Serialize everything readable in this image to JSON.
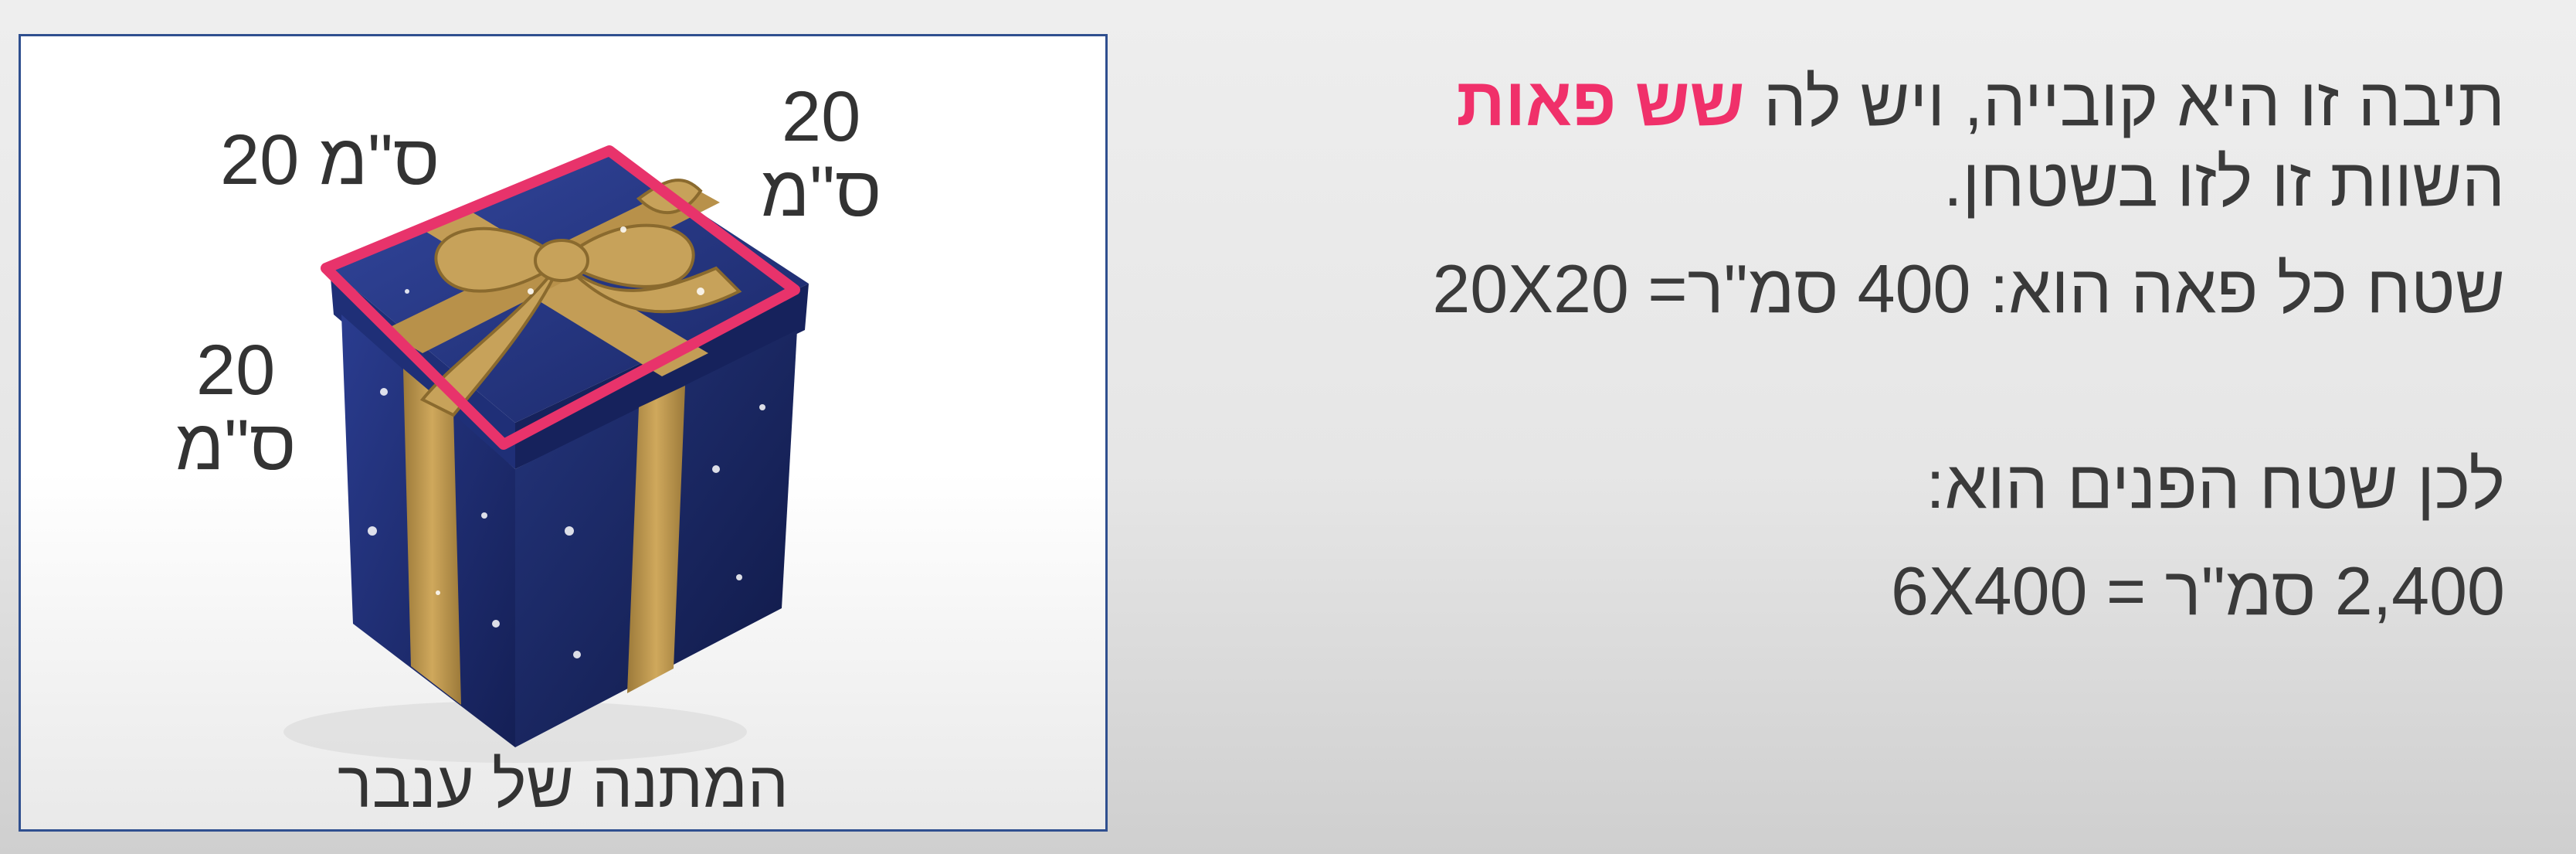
{
  "image_panel": {
    "dim_top_left": "20 ס\"מ",
    "dim_top_right_number": "20",
    "dim_top_right_unit": "ס\"מ",
    "dim_left_number": "20",
    "dim_left_unit": "ס\"מ",
    "caption": "המתנה של ענבר",
    "colors": {
      "frame_border": "#2f4f8f",
      "outline_highlight": "#e8336b",
      "box_blue": "#1d2d6b",
      "ribbon_gold": "#b8914a"
    }
  },
  "text_panel": {
    "line1_before": "תיבה זו היא קובייה, ויש לה ",
    "line1_highlight": "שש פאות",
    "line2": "השוות זו לזו בשטחן.",
    "line3": "שטח כל פאה הוא: 400 סמ\"ר= 20X20",
    "line4": "לכן שטח הפנים הוא:",
    "line5": "2,400 סמ\"ר = 6X400",
    "colors": {
      "text": "#3a3a3a",
      "highlight": "#f0306a"
    }
  }
}
